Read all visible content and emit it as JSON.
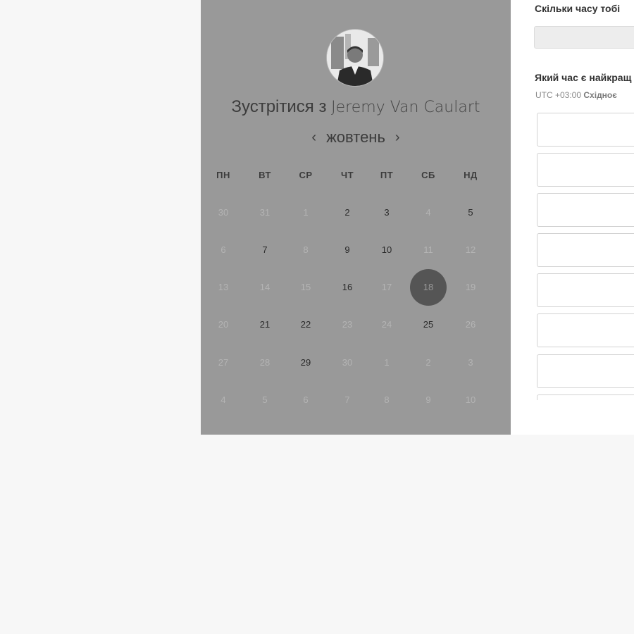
{
  "booking": {
    "title_prefix": "Зустрітися з",
    "host_name": "Jeremy Van Caulart",
    "month": "жовтень",
    "prev_arrow": "‹",
    "next_arrow": "›"
  },
  "calendar": {
    "weekdays": [
      "ПН",
      "ВТ",
      "СР",
      "ЧТ",
      "ПТ",
      "СБ",
      "НД"
    ],
    "weeks": [
      [
        {
          "d": "30",
          "s": "muted"
        },
        {
          "d": "31",
          "s": "muted"
        },
        {
          "d": "1",
          "s": "muted"
        },
        {
          "d": "2",
          "s": "avail"
        },
        {
          "d": "3",
          "s": "avail"
        },
        {
          "d": "4",
          "s": "muted"
        },
        {
          "d": "5",
          "s": "avail"
        }
      ],
      [
        {
          "d": "6",
          "s": "muted"
        },
        {
          "d": "7",
          "s": "avail"
        },
        {
          "d": "8",
          "s": "muted"
        },
        {
          "d": "9",
          "s": "avail"
        },
        {
          "d": "10",
          "s": "avail"
        },
        {
          "d": "11",
          "s": "muted"
        },
        {
          "d": "12",
          "s": "muted"
        }
      ],
      [
        {
          "d": "13",
          "s": "muted"
        },
        {
          "d": "14",
          "s": "muted"
        },
        {
          "d": "15",
          "s": "muted"
        },
        {
          "d": "16",
          "s": "avail"
        },
        {
          "d": "17",
          "s": "muted"
        },
        {
          "d": "18",
          "s": "selected"
        },
        {
          "d": "19",
          "s": "muted"
        }
      ],
      [
        {
          "d": "20",
          "s": "muted"
        },
        {
          "d": "21",
          "s": "avail"
        },
        {
          "d": "22",
          "s": "avail"
        },
        {
          "d": "23",
          "s": "muted"
        },
        {
          "d": "24",
          "s": "muted"
        },
        {
          "d": "25",
          "s": "avail"
        },
        {
          "d": "26",
          "s": "muted"
        }
      ],
      [
        {
          "d": "27",
          "s": "muted"
        },
        {
          "d": "28",
          "s": "muted"
        },
        {
          "d": "29",
          "s": "avail"
        },
        {
          "d": "30",
          "s": "muted"
        },
        {
          "d": "1",
          "s": "muted"
        },
        {
          "d": "2",
          "s": "muted"
        },
        {
          "d": "3",
          "s": "muted"
        }
      ],
      [
        {
          "d": "4",
          "s": "muted"
        },
        {
          "d": "5",
          "s": "muted"
        },
        {
          "d": "6",
          "s": "muted"
        },
        {
          "d": "7",
          "s": "muted"
        },
        {
          "d": "8",
          "s": "muted"
        },
        {
          "d": "9",
          "s": "muted"
        },
        {
          "d": "10",
          "s": "muted"
        }
      ]
    ]
  },
  "form": {
    "duration_question": "Скільки часу тобі",
    "time_question": "Який час є найкращ",
    "timezone_offset": "UTC +03:00",
    "timezone_name": "Східноє"
  },
  "colors": {
    "overlay_gray": "#999999",
    "selected_day": "#555555",
    "page_bg": "#f7f7f7"
  }
}
